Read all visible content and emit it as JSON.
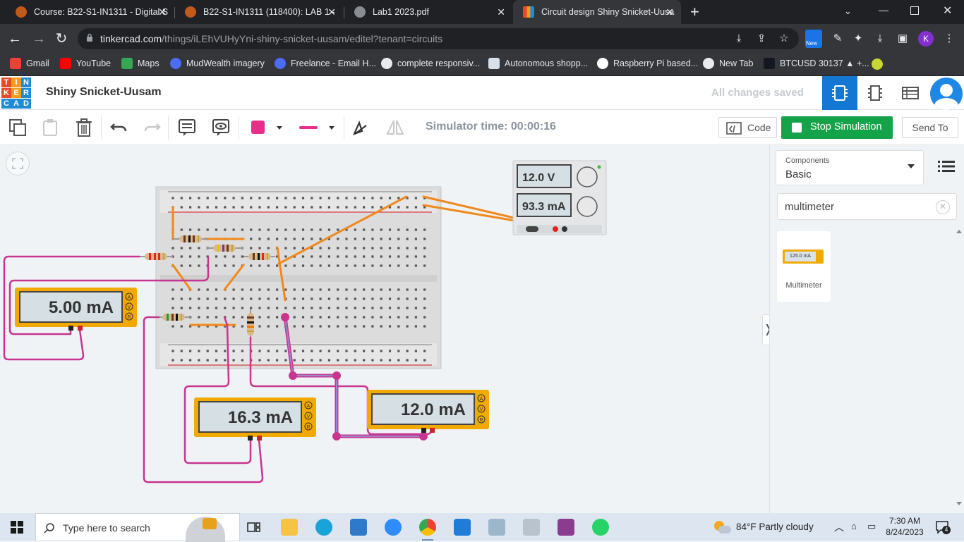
{
  "browser": {
    "tabs": [
      {
        "label": "Course: B22-S1-IN1311 - Digital S"
      },
      {
        "label": "B22-S1-IN1311 (118400): LAB 1 -"
      },
      {
        "label": "Lab1 2023.pdf"
      },
      {
        "label": "Circuit design Shiny Snicket-Uusa"
      }
    ],
    "url_host": "tinkercad.com",
    "url_path": "/things/iLEhVUHyYni-shiny-snicket-uusam/editel?tenant=circuits",
    "profile_initial": "K",
    "ext_badge": "New",
    "bookmarks": [
      {
        "label": "Gmail"
      },
      {
        "label": "YouTube"
      },
      {
        "label": "Maps"
      },
      {
        "label": "MudWealth imagery"
      },
      {
        "label": "Freelance - Email H..."
      },
      {
        "label": "complete responsiv..."
      },
      {
        "label": "Autonomous shopp..."
      },
      {
        "label": "Raspberry Pi based..."
      },
      {
        "label": "New Tab"
      },
      {
        "label": "BTCUSD 30137 ▲ +..."
      }
    ]
  },
  "app": {
    "logo": [
      "T",
      "I",
      "N",
      "K",
      "E",
      "R",
      "C",
      "A",
      "D"
    ],
    "design_name": "Shiny Snicket-Uusam",
    "save_status": "All changes saved"
  },
  "toolbar": {
    "sim_time": "Simulator time: 00:00:16",
    "code_label": "Code",
    "stop_label": "Stop Simulation",
    "send_label": "Send To",
    "fill_color": "#e62e8b",
    "line_color": "#e62e8b"
  },
  "circuit": {
    "power_supply": {
      "voltage": "12.0 V",
      "current": "93.3 mA"
    },
    "meters": [
      {
        "reading": "5.00 mA"
      },
      {
        "reading": "16.3 mA"
      },
      {
        "reading": "12.0 mA"
      }
    ],
    "meter_modes": [
      "A",
      "V",
      "R"
    ],
    "wire_colors": {
      "orange": "#f0891c",
      "magenta": "#c8348f"
    }
  },
  "panel": {
    "components_label": "Components",
    "components_value": "Basic",
    "search_value": "multimeter",
    "result_name": "Multimeter",
    "result_reading": "125.0 mA"
  },
  "taskbar": {
    "search_placeholder": "Type here to search",
    "weather": "84°F  Partly cloudy",
    "time": "7:30 AM",
    "date": "8/24/2023",
    "notif_count": "4"
  }
}
